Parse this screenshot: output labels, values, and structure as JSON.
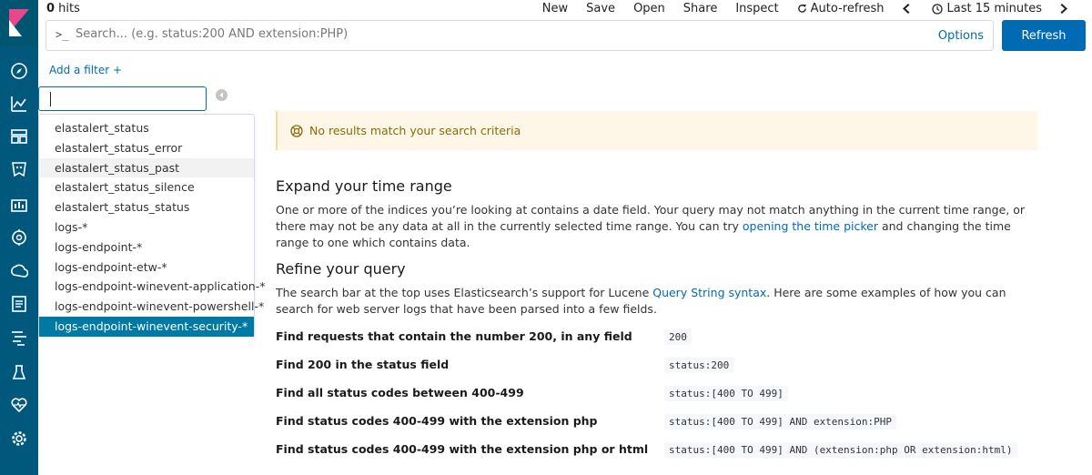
{
  "top": {
    "hits_count": "0",
    "hits_label": " hits",
    "menu": {
      "new": "New",
      "save": "Save",
      "open": "Open",
      "share": "Share",
      "inspect": "Inspect",
      "auto_refresh": "Auto-refresh",
      "time_range": "Last 15 minutes"
    }
  },
  "search": {
    "prompt": ">_",
    "placeholder": "Search... (e.g. status:200 AND extension:PHP)",
    "options_label": "Options",
    "refresh_label": "Refresh"
  },
  "filter": {
    "add_label": "Add a filter +"
  },
  "index_patterns": [
    "elastalert_status",
    "elastalert_status_error",
    "elastalert_status_past",
    "elastalert_status_silence",
    "elastalert_status_status",
    "logs-*",
    "logs-endpoint-*",
    "logs-endpoint-etw-*",
    "logs-endpoint-winevent-application-*",
    "logs-endpoint-winevent-powershell-*",
    "logs-endpoint-winevent-security-*"
  ],
  "main": {
    "callout": "No results match your search criteria",
    "expand": {
      "title": "Expand your time range",
      "text_a": "One or more of the indices you’re looking at contains a date field. Your query may not match anything in the current time range, or there may not be any data at all in the currently selected time range. You can try ",
      "link": "opening the time picker",
      "text_b": " and changing the time range to one which contains data."
    },
    "refine": {
      "title": "Refine your query",
      "text_a": "The search bar at the top uses Elasticsearch’s support for Lucene ",
      "link": "Query String syntax",
      "text_b": ". Here are some examples of how you can search for web server logs that have been parsed into a few fields."
    },
    "examples": [
      {
        "label": "Find requests that contain the number 200, in any field",
        "code": "200"
      },
      {
        "label": "Find 200 in the status field",
        "code": "status:200"
      },
      {
        "label": "Find all status codes between 400-499",
        "code": "status:[400 TO 499]"
      },
      {
        "label": "Find status codes 400-499 with the extension php",
        "code": "status:[400 TO 499] AND extension:PHP"
      },
      {
        "label": "Find status codes 400-499 with the extension php or html",
        "code": "status:[400 TO 499] AND (extension:php OR extension:html)"
      }
    ]
  },
  "colors": {
    "nav_bg": "#00597c",
    "accent": "#006bb4",
    "selected_item": "#0079a5",
    "callout_bg": "#fef6e6"
  }
}
